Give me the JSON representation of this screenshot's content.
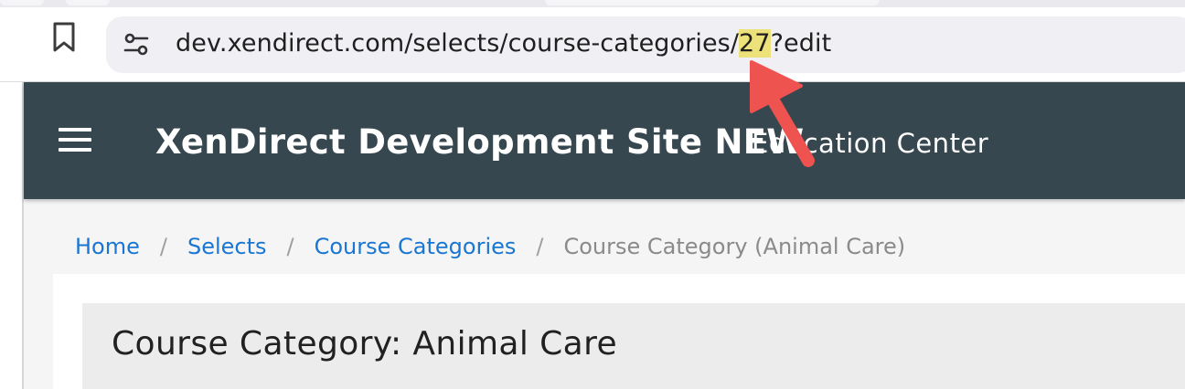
{
  "browser": {
    "address_bar": {
      "url_prefix": "dev.xendirect.com/selects/course-categories/",
      "url_highlight": "27",
      "url_suffix": "?edit"
    },
    "icons": {
      "bookmark": "bookmark-icon",
      "site_info": "tune-icon"
    }
  },
  "header": {
    "site_title": "XenDirect Development Site NEW",
    "subtitle": "Education Center",
    "menu_icon": "hamburger-icon",
    "background_color": "#37474f"
  },
  "breadcrumb": {
    "items": [
      {
        "label": "Home"
      },
      {
        "label": "Selects"
      },
      {
        "label": "Course Categories"
      }
    ],
    "separator": "/",
    "current": "Course Category (Animal Care)",
    "link_color": "#1976d2"
  },
  "content": {
    "title": "Course Category: Animal Care"
  },
  "annotation": {
    "arrow_color": "#ef5350",
    "highlight_color": "#ede17a"
  }
}
